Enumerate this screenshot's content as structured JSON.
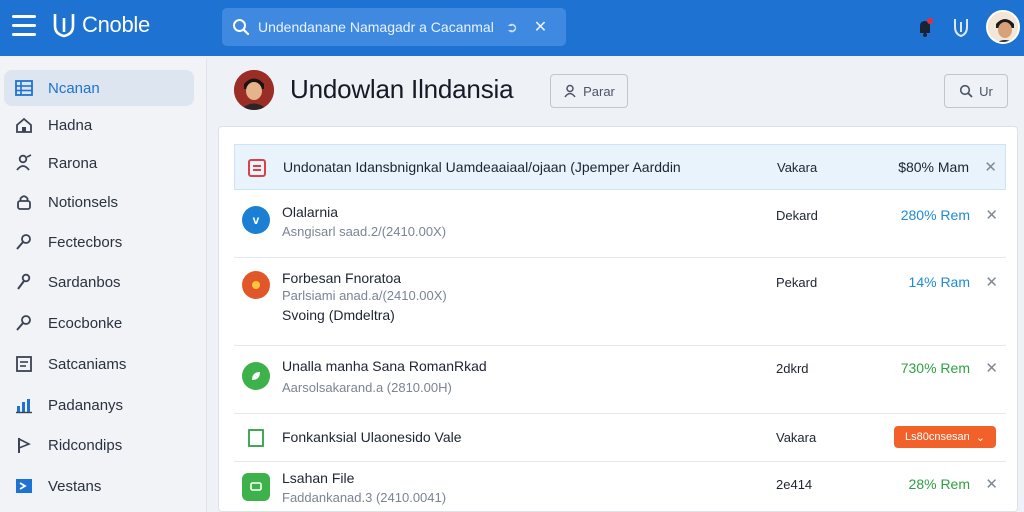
{
  "app": {
    "name": "Cnoble"
  },
  "search": {
    "placeholder": "Undendanane Namagadr a Cacanmal"
  },
  "sidebar": {
    "items": [
      {
        "label": "Ncanan",
        "icon": "grid-icon",
        "active": true
      },
      {
        "label": "Hadna",
        "icon": "home-icon"
      },
      {
        "label": "Rarona",
        "icon": "person-edit-icon"
      },
      {
        "label": "Notionsels",
        "icon": "lock-icon"
      },
      {
        "label": "Fectecbors",
        "icon": "key-icon"
      },
      {
        "label": "Sardanbos",
        "icon": "pen-icon"
      },
      {
        "label": "Ecocbonke",
        "icon": "search-tool-icon"
      },
      {
        "label": "Satcaniams",
        "icon": "doc-icon"
      },
      {
        "label": "Padananys",
        "icon": "chart-icon"
      },
      {
        "label": "Ridcondips",
        "icon": "flag-icon"
      },
      {
        "label": "Vestans",
        "icon": "arrow-box-icon"
      }
    ]
  },
  "header": {
    "title": "Undowlan Ilndansia",
    "filter_label": "Parar",
    "search_label": "Ur"
  },
  "rows": [
    {
      "title": "Undonatan Idansbnignkal Uamdeaaiaal/ojaan (Jpemper Aarddin",
      "type": "Vakara",
      "value": "$80% Mam",
      "color": "#1d2433",
      "icon": "doc-square-icon",
      "icon_color": "#d8404a"
    },
    {
      "title": "Olalarnia",
      "sub": "Asngisarl saad.2/(2410.00X)",
      "type": "Dekard",
      "value": "280% Rem",
      "color": "#1f8ad6",
      "icon": "circle-v-icon",
      "icon_color": "#1b7fd4"
    },
    {
      "title": "Forbesan Fnoratoa",
      "sub": "Parlsiami anad.a/(2410.00X)",
      "sub2": "Svoing (Dmdeltra)",
      "type": "Pekard",
      "value": "14% Ram",
      "color": "#1f8ad6",
      "icon": "sun-icon",
      "icon_color": "#e2572a"
    },
    {
      "title": "Unalla manha Sana RomanRkad",
      "sub": "Aarsolsakarand.a (2810.00H)",
      "type": "2dkrd",
      "value": "730% Rem",
      "color": "#2ea043",
      "icon": "leaf-icon",
      "icon_color": "#3db24a"
    },
    {
      "title": "Fonkanksial Ulaonesido Vale",
      "type": "Vakara",
      "value": "Ls80cnsesan",
      "color": "#ffffff",
      "icon": "file-outline-icon",
      "icon_color": "#2ea043",
      "badge": true
    },
    {
      "title": "Lsahan File",
      "sub": "Faddankanad.3 (2410.0041)",
      "type": "2e414",
      "value": "28% Rem",
      "color": "#2ea043",
      "icon": "chat-icon",
      "icon_color": "#3db24a"
    }
  ]
}
